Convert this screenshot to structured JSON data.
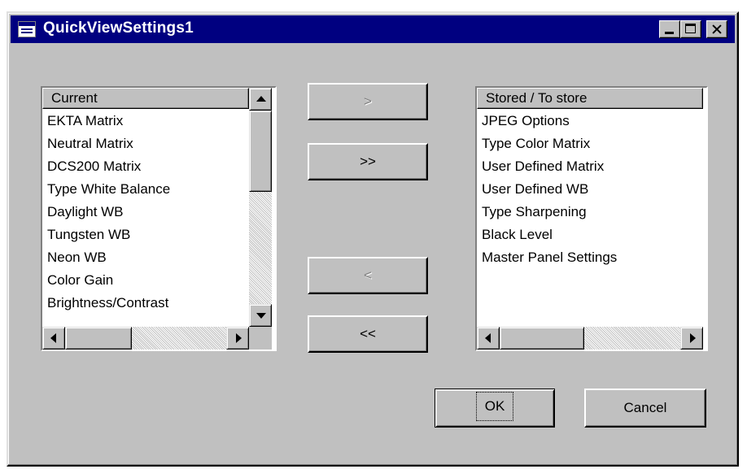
{
  "window": {
    "title": "QuickViewSettings1"
  },
  "current_list": {
    "header": "Current",
    "items": [
      "EKTA Matrix",
      "Neutral Matrix",
      "DCS200 Matrix",
      "Type White Balance",
      "Daylight WB",
      "Tungsten WB",
      "Neon WB",
      "Color Gain",
      "Brightness/Contrast"
    ]
  },
  "stored_list": {
    "header": "Stored / To store",
    "items": [
      "JPEG Options",
      "Type Color Matrix",
      "User Defined Matrix",
      "User Defined WB",
      "Type Sharpening",
      "Black Level",
      "Master Panel Settings"
    ]
  },
  "buttons": {
    "move_one_right": ">",
    "move_all_right": ">>",
    "move_one_left": "<",
    "move_all_left": "<<",
    "ok": "OK",
    "cancel": "Cancel"
  }
}
